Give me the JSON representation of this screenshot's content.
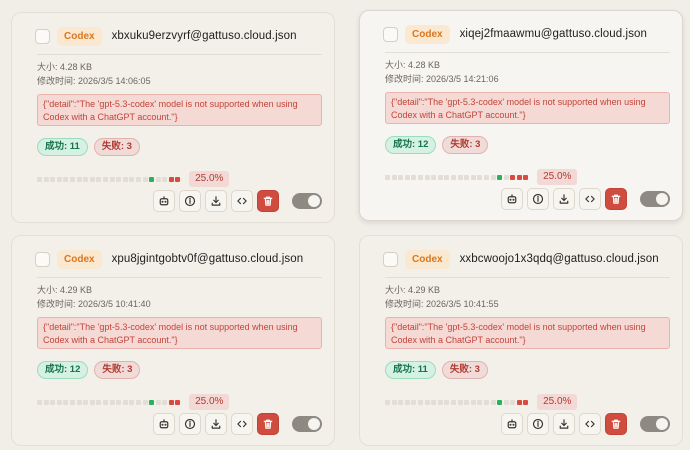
{
  "cards": [
    {
      "badge": "Codex",
      "filename": "xbxuku9erzvyrf@gattuso.cloud.json",
      "size": "大小: 4.28 KB",
      "modified": "修改时间: 2026/3/5 14:06:05",
      "error": "{\"detail\":\"The 'gpt-5.3-codex' model is not supported when using Codex with a ChatGPT account.\"}",
      "success_label": "成功: 11",
      "fail_label": "失败: 3",
      "rate": "25.0%",
      "bar": [
        "e",
        "e",
        "e",
        "e",
        "e",
        "e",
        "e",
        "e",
        "e",
        "e",
        "e",
        "e",
        "e",
        "e",
        "e",
        "e",
        "e",
        "s",
        "e",
        "e",
        "f",
        "f"
      ],
      "enabled": true
    },
    {
      "badge": "Codex",
      "filename": "xiqej2fmaawmu@gattuso.cloud.json",
      "size": "大小: 4.28 KB",
      "modified": "修改时间: 2026/3/5 14:21:06",
      "error": "{\"detail\":\"The 'gpt-5.3-codex' model is not supported when using Codex with a ChatGPT account.\"}",
      "success_label": "成功: 12",
      "fail_label": "失败: 3",
      "rate": "25.0%",
      "bar": [
        "e",
        "e",
        "e",
        "e",
        "e",
        "e",
        "e",
        "e",
        "e",
        "e",
        "e",
        "e",
        "e",
        "e",
        "e",
        "e",
        "e",
        "s",
        "e",
        "f",
        "f",
        "f"
      ],
      "enabled": true
    },
    {
      "badge": "Codex",
      "filename": "xpu8jgintgobtv0f@gattuso.cloud.json",
      "size": "大小: 4.29 KB",
      "modified": "修改时间: 2026/3/5 10:41:40",
      "error": "{\"detail\":\"The 'gpt-5.3-codex' model is not supported when using Codex with a ChatGPT account.\"}",
      "success_label": "成功: 12",
      "fail_label": "失败: 3",
      "rate": "25.0%",
      "bar": [
        "e",
        "e",
        "e",
        "e",
        "e",
        "e",
        "e",
        "e",
        "e",
        "e",
        "e",
        "e",
        "e",
        "e",
        "e",
        "e",
        "e",
        "s",
        "e",
        "e",
        "f",
        "f"
      ],
      "enabled": true
    },
    {
      "badge": "Codex",
      "filename": "xxbcwoojo1x3qdq@gattuso.cloud.json",
      "size": "大小: 4.29 KB",
      "modified": "修改时间: 2026/3/5 10:41:55",
      "error": "{\"detail\":\"The 'gpt-5.3-codex' model is not supported when using Codex with a ChatGPT account.\"}",
      "success_label": "成功: 11",
      "fail_label": "失败: 3",
      "rate": "25.0%",
      "bar": [
        "e",
        "e",
        "e",
        "e",
        "e",
        "e",
        "e",
        "e",
        "e",
        "e",
        "e",
        "e",
        "e",
        "e",
        "e",
        "e",
        "e",
        "s",
        "e",
        "e",
        "f",
        "f"
      ],
      "enabled": true
    }
  ],
  "actions": [
    {
      "name": "bot-icon"
    },
    {
      "name": "info-icon"
    },
    {
      "name": "download-icon"
    },
    {
      "name": "code-icon"
    },
    {
      "name": "trash-icon"
    }
  ],
  "colors": {
    "success": "#27b35c",
    "fail": "#d94a3f",
    "badge": "#d8771e",
    "danger": "#cf4c3f"
  }
}
